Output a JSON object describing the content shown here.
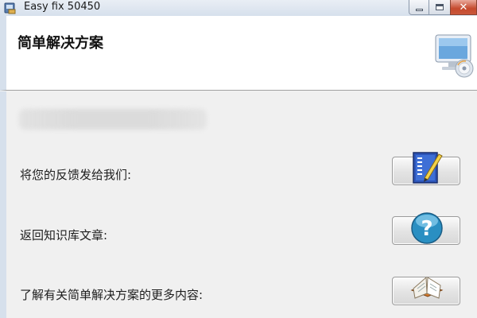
{
  "window": {
    "title": "Easy fix 50450",
    "icons": {
      "app": "program-icon",
      "minimize": "minimize-icon",
      "maximize": "maximize-icon",
      "close": "close-icon"
    }
  },
  "header": {
    "title": "简单解决方案",
    "icon": "computer-cd-icon"
  },
  "actions": [
    {
      "label": "将您的反馈发给我们:",
      "icon": "feedback-form-icon"
    },
    {
      "label": "返回知识库文章:",
      "icon": "help-question-icon"
    },
    {
      "label": "了解有关简单解决方案的更多内容:",
      "icon": "open-book-icon"
    }
  ],
  "colors": {
    "title_bar": "#dbe4ef",
    "close_button": "#c9573a",
    "help_icon": "#2a8fc2",
    "feedback_icon": "#2d55b8",
    "book_icon": "#d97a2b"
  }
}
